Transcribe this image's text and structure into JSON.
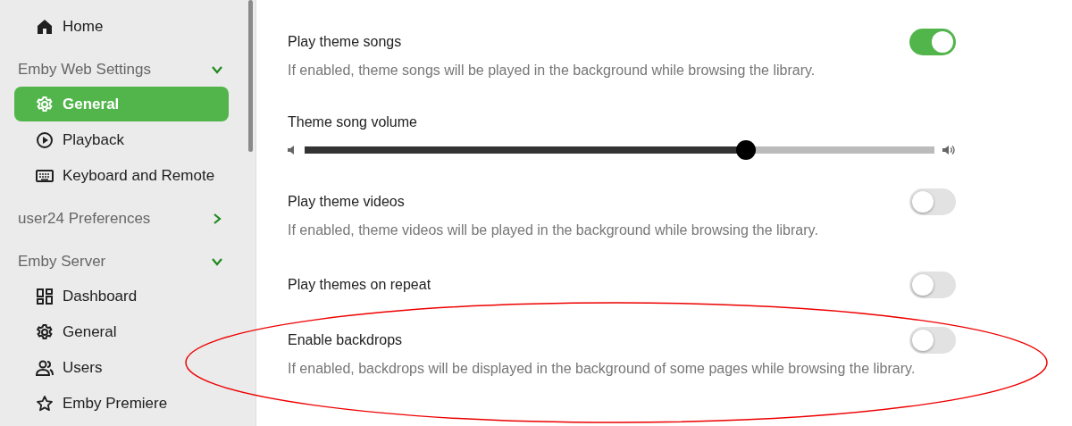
{
  "sidebar": {
    "groups": [
      {
        "items": [
          {
            "label": "Home",
            "selected": false
          }
        ]
      },
      {
        "header": "Emby Web Settings",
        "expanded": true,
        "items": [
          {
            "label": "General",
            "selected": true
          },
          {
            "label": "Playback",
            "selected": false
          },
          {
            "label": "Keyboard and Remote",
            "selected": false
          }
        ]
      },
      {
        "header": "user24 Preferences",
        "expanded": false
      },
      {
        "header": "Emby Server",
        "expanded": true,
        "items": [
          {
            "label": "Dashboard",
            "selected": false
          },
          {
            "label": "General",
            "selected": false
          },
          {
            "label": "Users",
            "selected": false
          },
          {
            "label": "Emby Premiere",
            "selected": false
          }
        ]
      }
    ]
  },
  "settings": [
    {
      "kind": "toggle",
      "title": "Play theme songs",
      "description": "If enabled, theme songs will be played in the background while browsing the library.",
      "on": true,
      "circled": false
    },
    {
      "kind": "slider",
      "title": "Theme song volume",
      "level": 0.7
    },
    {
      "kind": "toggle",
      "title": "Play theme videos",
      "description": "If enabled, theme videos will be played in the background while browsing the library.",
      "on": false,
      "circled": false
    },
    {
      "kind": "toggle",
      "title": "Play themes on repeat",
      "on": false,
      "circled": false
    },
    {
      "kind": "toggle",
      "title": "Enable backdrops",
      "description": "If enabled, backdrops will be displayed in the background of some pages while browsing the library.",
      "on": false,
      "circled": true
    }
  ]
}
